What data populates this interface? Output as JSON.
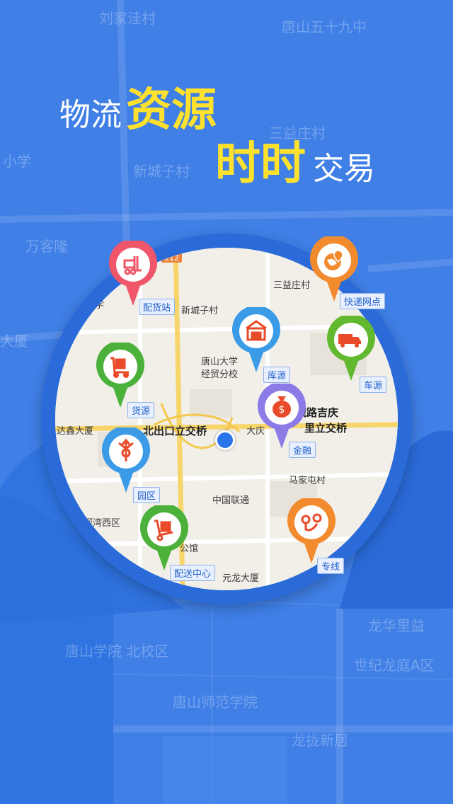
{
  "headline": {
    "line1_white": "物流",
    "line1_yellow": "资源",
    "line2_yellow": "时时",
    "line2_white": "交易"
  },
  "background_labels": [
    "刘家洼村",
    "唐山五十九中",
    "三益庄村",
    "小学",
    "新城子村",
    "万客隆",
    "大厦",
    "龙华里益",
    "世纪龙庭A区",
    "唐山学院 北校区",
    "唐山师范学院",
    "龙拢新居"
  ],
  "map": {
    "road_badge": "112",
    "labels": [
      "三益庄村",
      "新城子村",
      "唐山大学",
      "经贸分校",
      "城路吉庆",
      "里立交桥",
      "达鑫大厦",
      "北出口立交桥",
      "大庆",
      "马家屯村",
      "中国联通",
      "河湾西区",
      "公馆",
      "元龙大厦",
      "学"
    ]
  },
  "pins": [
    {
      "id": "peihuozhan",
      "label": "配货站",
      "color": "#f0566a",
      "icon": "forklift-icon"
    },
    {
      "id": "kuaidi",
      "label": "快递网点",
      "color": "#f28a2e",
      "icon": "globe-location-icon"
    },
    {
      "id": "kuyuan",
      "label": "库源",
      "color": "#3b9be6",
      "icon": "warehouse-icon"
    },
    {
      "id": "cheyuan",
      "label": "车源",
      "color": "#62b82e",
      "icon": "truck-icon"
    },
    {
      "id": "huoyuan",
      "label": "货源",
      "color": "#4bb13a",
      "icon": "cart-icon"
    },
    {
      "id": "jinrong",
      "label": "金融",
      "color": "#8a7be6",
      "icon": "money-bag-icon"
    },
    {
      "id": "yuanqu",
      "label": "园区",
      "color": "#3b9be6",
      "icon": "route-split-icon"
    },
    {
      "id": "peisong",
      "label": "配送中心",
      "color": "#4bb13a",
      "icon": "hand-truck-icon"
    },
    {
      "id": "zhuanxian",
      "label": "专线",
      "color": "#f28a2e",
      "icon": "route-points-icon"
    }
  ]
}
